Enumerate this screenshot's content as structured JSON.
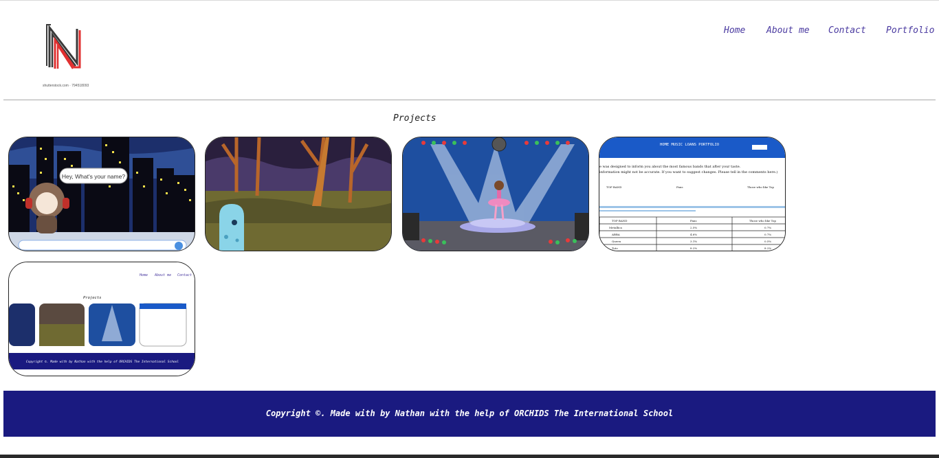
{
  "header": {
    "logo_caption": "shutterstock.com · 794518093",
    "nav": [
      "Home",
      "About me",
      "Contact",
      "Portfolio"
    ]
  },
  "main": {
    "section_title": "Projects",
    "projects": [
      {
        "name": "chatbot-scratch-project",
        "speech": "Hey, What's your name?"
      },
      {
        "name": "forest-ghost-project"
      },
      {
        "name": "ballerina-stage-project"
      },
      {
        "name": "bands-info-website"
      },
      {
        "name": "portfolio-website"
      }
    ]
  },
  "thumbnail_texts": {
    "bands_nav": "HOME  MUSIC  LOANS  PORTFOLIO",
    "bands_line1": "e was designed to inform you about the most famous bands that after your taste.",
    "bands_line2": "information might not be accurate. If you want to suggest changes. Please tell in the comments here.)",
    "bands_table_headers": [
      "TOP BAND",
      "Fans",
      "Those who like Top"
    ],
    "bands_table_rows": [
      [
        "Metallica",
        "2.5%",
        "0.7%"
      ],
      [
        "ABBA",
        "4.6%",
        "0.7%"
      ],
      [
        "Queen",
        "3.1%",
        "0.5%"
      ],
      [
        "Toto",
        "8.2%",
        "8.2%"
      ]
    ],
    "mini_nav": [
      "Home",
      "About me",
      "Contact"
    ],
    "mini_title": "Projects",
    "mini_footer": "Copyright ©. Made with by Nathan with the help of   ORCHIDS The International School"
  },
  "footer": {
    "text": "Copyright ©. Made with by Nathan with the help of   ORCHIDS The International School"
  },
  "colors": {
    "nav_link": "#4a3aa0",
    "footer_bg": "#1a1a80",
    "logo_red": "#e03030",
    "logo_dark": "#3a3a3a"
  }
}
